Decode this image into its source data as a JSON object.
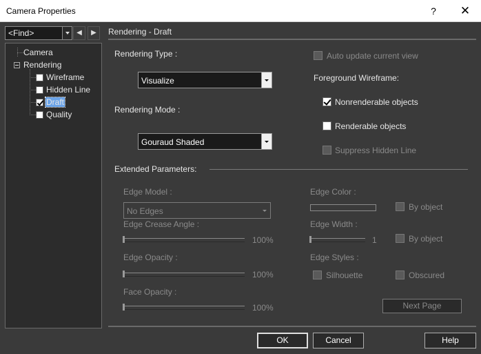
{
  "window": {
    "title": "Camera Properties",
    "help_glyph": "?",
    "close_glyph": "✕"
  },
  "find": {
    "value": "<Find>",
    "prev_glyph": "◀",
    "next_glyph": "▶"
  },
  "tree": {
    "camera": "Camera",
    "rendering": "Rendering",
    "wireframe": "Wireframe",
    "hidden_line": "Hidden Line",
    "draft": "Draft",
    "quality": "Quality"
  },
  "panel": {
    "header": "Rendering - Draft",
    "rendering_type_label": "Rendering Type :",
    "rendering_type_value": "Visualize",
    "rendering_mode_label": "Rendering Mode :",
    "rendering_mode_value": "Gouraud Shaded",
    "auto_update_label": "Auto update current view",
    "foreground_wireframe_label": "Foreground Wireframe:",
    "nonrenderable_label": "Nonrenderable objects",
    "renderable_label": "Renderable objects",
    "suppress_hidden_label": "Suppress Hidden Line",
    "extended_label": "Extended Parameters:",
    "edge_model_label": "Edge Model :",
    "edge_model_value": "No Edges",
    "edge_crease_label": "Edge Crease Angle :",
    "edge_crease_value": "100%",
    "edge_opacity_label": "Edge Opacity :",
    "edge_opacity_value": "100%",
    "face_opacity_label": "Face Opacity :",
    "face_opacity_value": "100%",
    "edge_color_label": "Edge Color :",
    "by_object_label_1": "By object",
    "edge_width_label": "Edge Width :",
    "edge_width_value": "1",
    "by_object_label_2": "By object",
    "edge_styles_label": "Edge Styles :",
    "silhouette_label": "Silhouette",
    "obscured_label": "Obscured",
    "next_page_label": "Next Page"
  },
  "states": {
    "auto_update": false,
    "nonrenderable": true,
    "renderable": false,
    "suppress_hidden": false,
    "wireframe": false,
    "hidden_line": false,
    "draft": true,
    "quality": false,
    "edge_crease_level": 0,
    "edge_opacity_level": 0,
    "face_opacity_level": 0,
    "edge_width_level": 0
  },
  "footer": {
    "ok_label": "OK",
    "cancel_label": "Cancel",
    "help_label": "Help"
  },
  "colors": {
    "background": "#3a3a3a",
    "selection": "#6aa3e8",
    "titlebar": "#ffffff"
  }
}
